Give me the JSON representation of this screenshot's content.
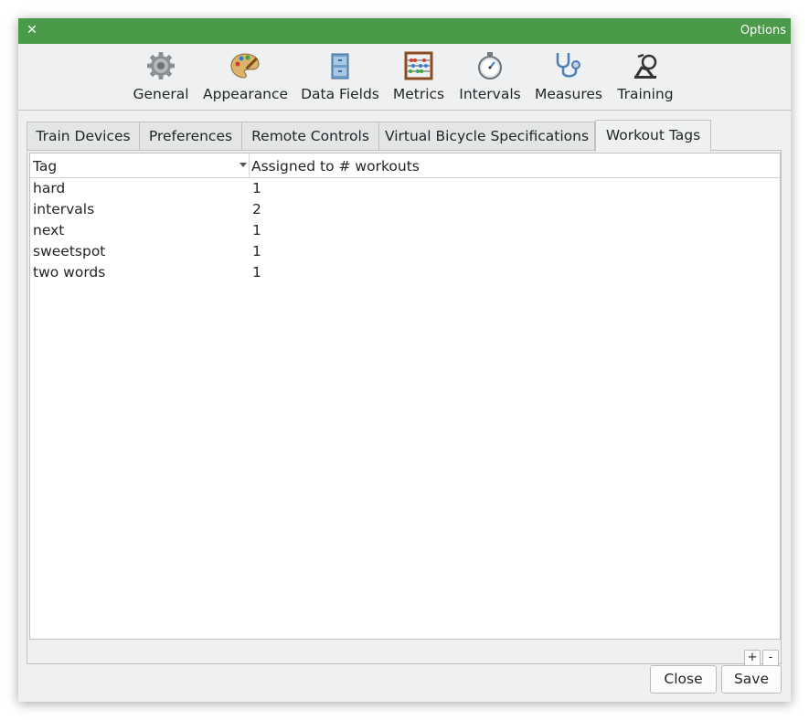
{
  "window": {
    "title": "Options"
  },
  "toolbar": {
    "items": [
      {
        "label": "General",
        "icon": "gear-icon"
      },
      {
        "label": "Appearance",
        "icon": "palette-icon"
      },
      {
        "label": "Data Fields",
        "icon": "filing-cabinet-icon"
      },
      {
        "label": "Metrics",
        "icon": "abacus-icon"
      },
      {
        "label": "Intervals",
        "icon": "stopwatch-icon"
      },
      {
        "label": "Measures",
        "icon": "stethoscope-icon"
      },
      {
        "label": "Training",
        "icon": "bike-trainer-icon"
      }
    ]
  },
  "tabs": [
    {
      "label": "Train Devices"
    },
    {
      "label": "Preferences"
    },
    {
      "label": "Remote Controls"
    },
    {
      "label": "Virtual Bicycle Specifications"
    },
    {
      "label": "Workout Tags",
      "active": true
    }
  ],
  "table": {
    "columns": [
      "Tag",
      "Assigned to # workouts"
    ],
    "rows": [
      {
        "tag": "hard",
        "count": "1"
      },
      {
        "tag": "intervals",
        "count": "2"
      },
      {
        "tag": "next",
        "count": "1"
      },
      {
        "tag": "sweetspot",
        "count": "1"
      },
      {
        "tag": "two words",
        "count": "1"
      }
    ]
  },
  "buttons": {
    "add": "+",
    "remove": "-",
    "close": "Close",
    "save": "Save"
  },
  "colors": {
    "titlebar": "#4a9a4a",
    "background": "#eff0f1"
  }
}
